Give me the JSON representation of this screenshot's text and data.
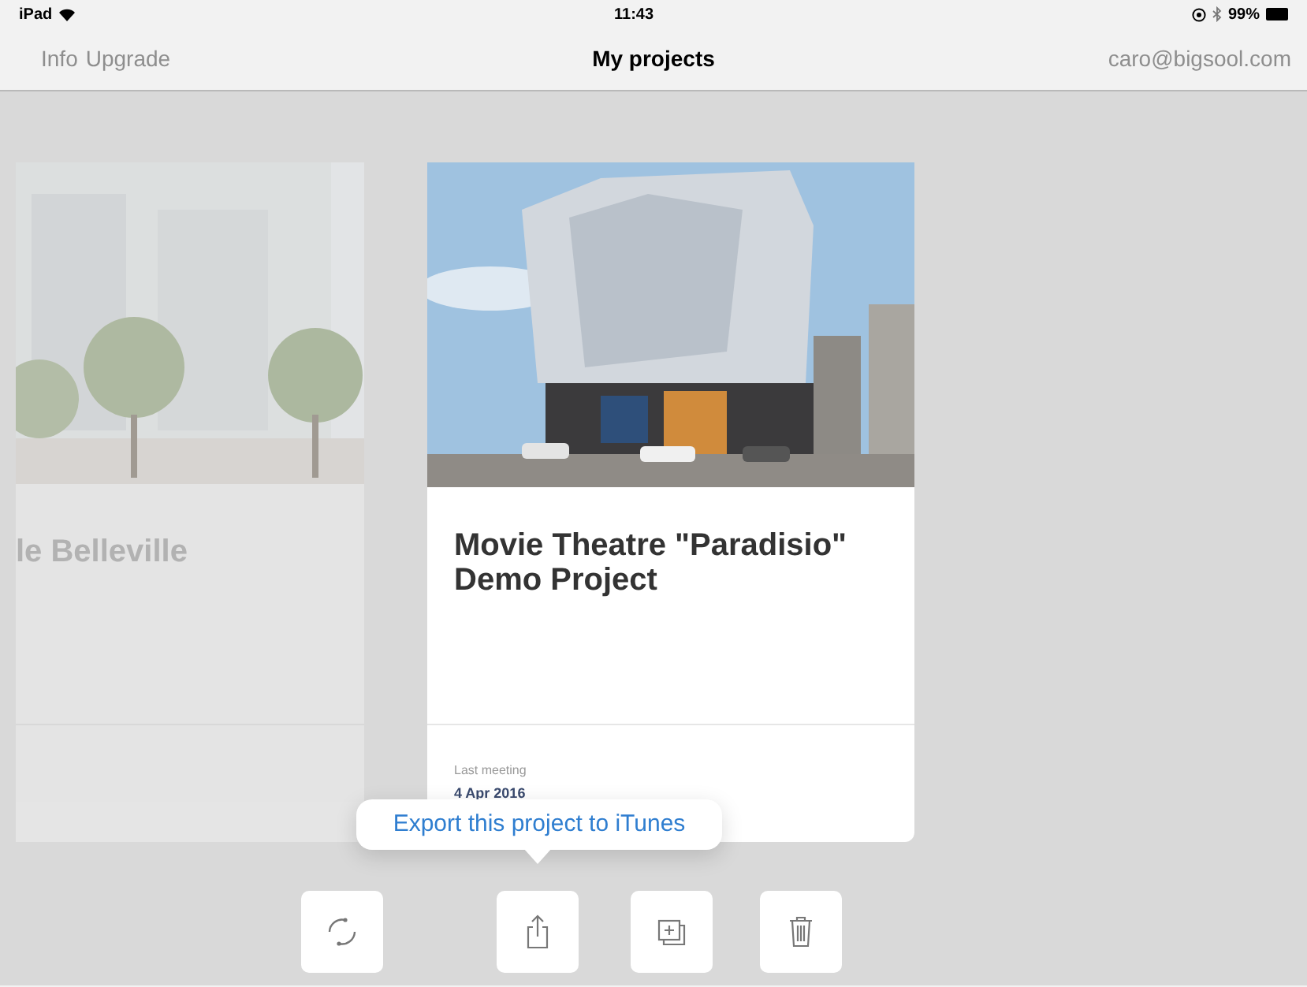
{
  "status_bar": {
    "device": "iPad",
    "time": "11:43",
    "battery": "99%"
  },
  "nav": {
    "left_items": [
      "Info",
      "Upgrade"
    ],
    "title": "My projects",
    "account": "caro@bigsool.com"
  },
  "projects": [
    {
      "kind": "picture",
      "title": "le Belleville",
      "selected": false
    },
    {
      "kind": "picture",
      "title": "Movie Theatre \"Paradisio\" Demo Project",
      "selected": true,
      "meeting_label": "Last meeting",
      "meeting_date": "4 Apr 2016"
    }
  ],
  "tooltip": "Export this project to iTunes",
  "actions": [
    {
      "kind": "sync"
    },
    {
      "kind": "export"
    },
    {
      "kind": "duplicate"
    },
    {
      "kind": "delete"
    }
  ]
}
